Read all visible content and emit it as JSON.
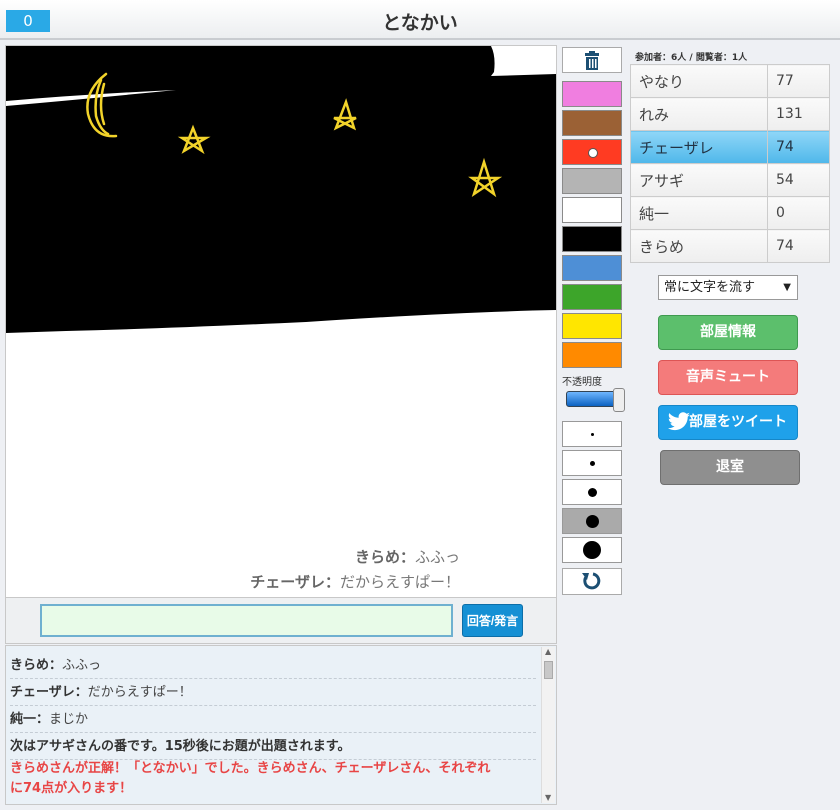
{
  "header": {
    "timer": "0",
    "title": "となかい"
  },
  "canvas": {
    "overlay_messages": [
      {
        "name": "きらめ：",
        "text": "ふふっ"
      },
      {
        "name": "チェーザレ：",
        "text": "だからえすぱー！"
      }
    ]
  },
  "tools": {
    "colors": [
      "#f07ee0",
      "#9b6135",
      "#ff3b22",
      "#b4b4b4",
      "#ffffff",
      "#000000",
      "#4e8fd6",
      "#3da52a",
      "#ffe600",
      "#ff8a00"
    ],
    "selected_color_index": 2,
    "opacity_label": "不透明度",
    "opacity_value": 1.0,
    "brush_sizes": [
      3,
      5,
      9,
      13,
      18
    ],
    "selected_brush_index": 3
  },
  "room": {
    "info_label": "参加者：6人 / 閲覧者：1人",
    "players": [
      {
        "name": "やなり",
        "score": "77"
      },
      {
        "name": "れみ",
        "score": "131"
      },
      {
        "name": "チェーザレ",
        "score": "74",
        "active": true
      },
      {
        "name": "アサギ",
        "score": "54"
      },
      {
        "name": "純一",
        "score": "0"
      },
      {
        "name": "きらめ",
        "score": "74"
      }
    ],
    "flow_select": "常に文字を流す",
    "buttons": {
      "info": "部屋情報",
      "mute": "音声ミュート",
      "tweet": "部屋をツイート",
      "exit": "退室"
    }
  },
  "input": {
    "value": "",
    "send_label": "回答/発言"
  },
  "chat": {
    "messages": [
      {
        "name": "きらめ：",
        "text": "ふふっ"
      },
      {
        "name": "チェーザレ：",
        "text": "だからえすぱー！"
      },
      {
        "name": "純一：",
        "text": "まじか"
      }
    ],
    "system": "次はアサギさんの番です。15秒後にお題が出題されます。",
    "correct_line1": "きらめさんが正解！「となかい」でした。きらめさん、チェーザレさん、それぞれ",
    "correct_line2": "に74点が入ります！"
  }
}
